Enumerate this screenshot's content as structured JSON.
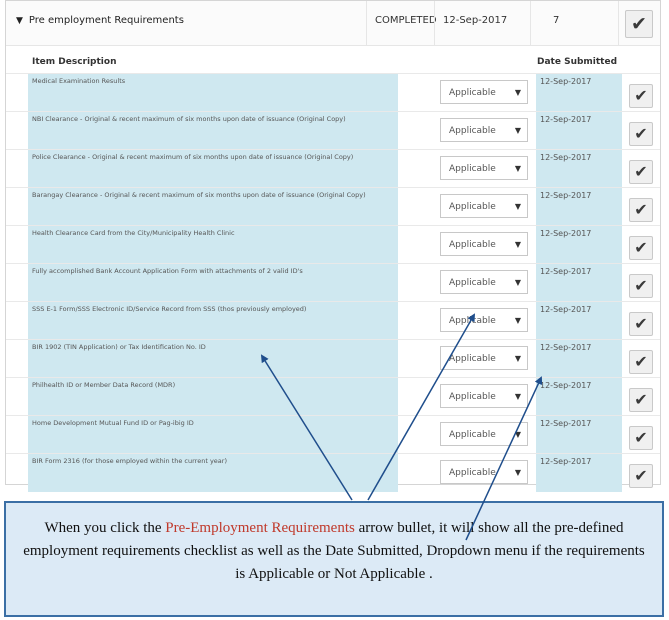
{
  "section": {
    "title": "Pre employment Requirements",
    "status": "COMPLETED",
    "date": "12-Sep-2017",
    "count": "7",
    "check_glyph": "✔"
  },
  "columns": {
    "item_description": "Item Description",
    "date_submitted": "Date Submitted"
  },
  "items": [
    {
      "description": "Medical Examination Results",
      "applicability": "Applicable",
      "date": "12-Sep-2017"
    },
    {
      "description": "NBI Clearance - Original & recent maximum of six months upon date of issuance (Original Copy)",
      "applicability": "Applicable",
      "date": "12-Sep-2017"
    },
    {
      "description": "Police Clearance - Original & recent maximum of six months upon date of issuance (Original Copy)",
      "applicability": "Applicable",
      "date": "12-Sep-2017"
    },
    {
      "description": "Barangay Clearance - Original & recent maximum of six months upon date of issuance (Original Copy)",
      "applicability": "Applicable",
      "date": "12-Sep-2017"
    },
    {
      "description": "Health Clearance Card from the City/Municipality Health Clinic",
      "applicability": "Applicable",
      "date": "12-Sep-2017"
    },
    {
      "description": "Fully accomplished Bank Account Application Form with attachments of 2 valid ID's",
      "applicability": "Applicable",
      "date": "12-Sep-2017"
    },
    {
      "description": "SSS E-1 Form/SSS Electronic ID/Service Record from SSS (thos previously employed)",
      "applicability": "Applicable",
      "date": "12-Sep-2017"
    },
    {
      "description": "BIR 1902 (TIN Application) or Tax Identification No. ID",
      "applicability": "Applicable",
      "date": "12-Sep-2017"
    },
    {
      "description": "Philhealth ID or Member Data Record (MDR)",
      "applicability": "Applicable",
      "date": "12-Sep-2017"
    },
    {
      "description": "Home Development Mutual Fund ID or Pag-ibig ID",
      "applicability": "Applicable",
      "date": "12-Sep-2017"
    },
    {
      "description": "BIR Form 2316 (for those employed within the current year)",
      "applicability": "Applicable",
      "date": "12-Sep-2017"
    }
  ],
  "caption": {
    "part1": "When you click the ",
    "highlight": "Pre-Employment Requirements",
    "part2": "  arrow bullet, it will show all the pre-defined employment requirements checklist as well as the   Date Submitted, Dropdown menu if the requirements is Applicable or Not Applicable  .",
    "highlight_color": "#c0392b"
  },
  "colors": {
    "row_highlight": "#cfe8f0",
    "caption_background": "#dceaf6",
    "caption_border": "#3b6fa5",
    "arrow": "#1f4e8c"
  }
}
